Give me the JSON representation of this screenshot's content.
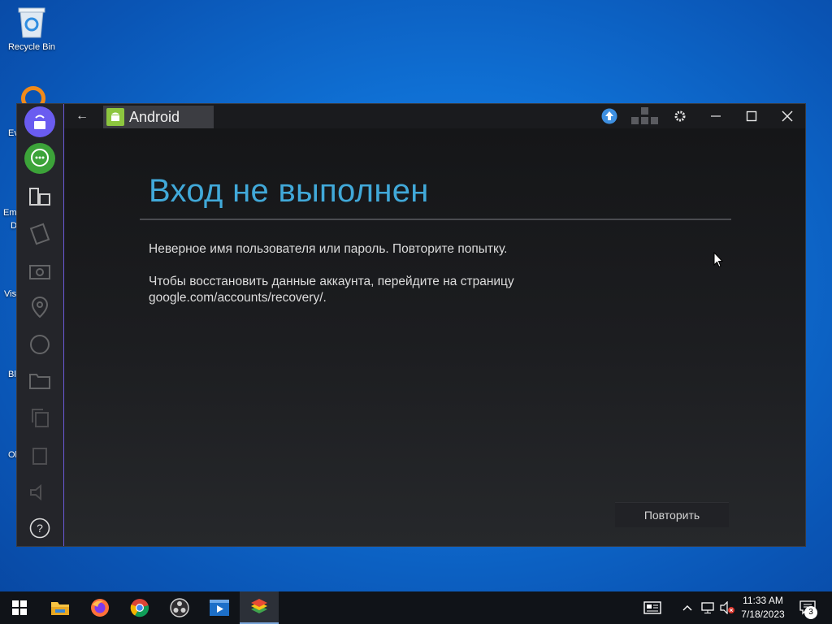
{
  "desktop": {
    "recycle_bin_label": "Recycle Bin",
    "partial_labels": [
      "Ev",
      "Em",
      "D",
      "Vis",
      "Bl",
      "Ol"
    ]
  },
  "window": {
    "tab_title": "Android",
    "back_label": "←"
  },
  "dialog": {
    "title": "Вход не выполнен",
    "message_1": "Неверное имя пользователя или пароль. Повторите попытку.",
    "message_2": "Чтобы восстановить данные аккаунта, перейдите на страницу google.com/accounts/recovery/.",
    "retry_label": "Повторить"
  },
  "taskbar": {
    "time": "11:33 AM",
    "date": "7/18/2023",
    "notification_count": "3"
  },
  "colors": {
    "accent_title": "#41a9d9",
    "sidebar_border": "#6a59d8"
  }
}
